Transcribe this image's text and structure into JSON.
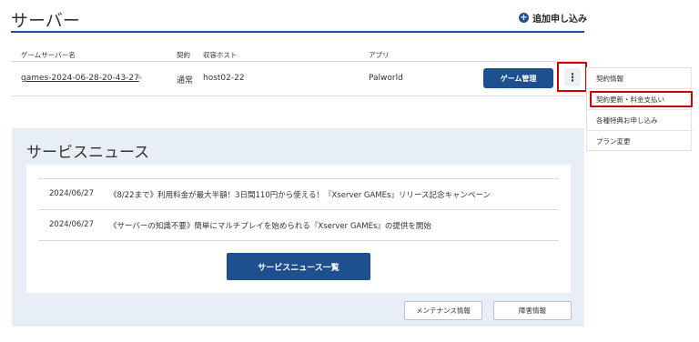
{
  "header": {
    "title": "サーバー",
    "add_label": "追加申し込み",
    "add_icon": "plus-circle-icon"
  },
  "table": {
    "columns": [
      "ゲームサーバー名",
      "契約",
      "収容ホスト",
      "アプリ"
    ],
    "row": {
      "name": "games-2024-06-28-20-43-27",
      "contract": "通常",
      "host": "host02-22",
      "app": "Palworld",
      "manage_label": "ゲーム管理"
    }
  },
  "menu": {
    "items": [
      "契約情報",
      "契約更新・料金支払い",
      "各種特典お申し込み",
      "プラン変更"
    ]
  },
  "news": {
    "title": "サービスニュース",
    "items": [
      {
        "date": "2024/06/27",
        "text": "《8/22まで》利用料金が最大半額！3日間110円から使える！『Xserver GAMEs』リリース記念キャンペーン"
      },
      {
        "date": "2024/06/27",
        "text": "《サーバーの知識不要》簡単にマルチプレイを始められる『Xserver GAMEs』の提供を開始"
      }
    ],
    "all_label": "サービスニュース一覧"
  },
  "footer": {
    "maintenance_label": "メンテナンス情報",
    "failure_label": "障害情報"
  },
  "colors": {
    "accent": "#1e4f8f",
    "highlight": "#d10000"
  }
}
